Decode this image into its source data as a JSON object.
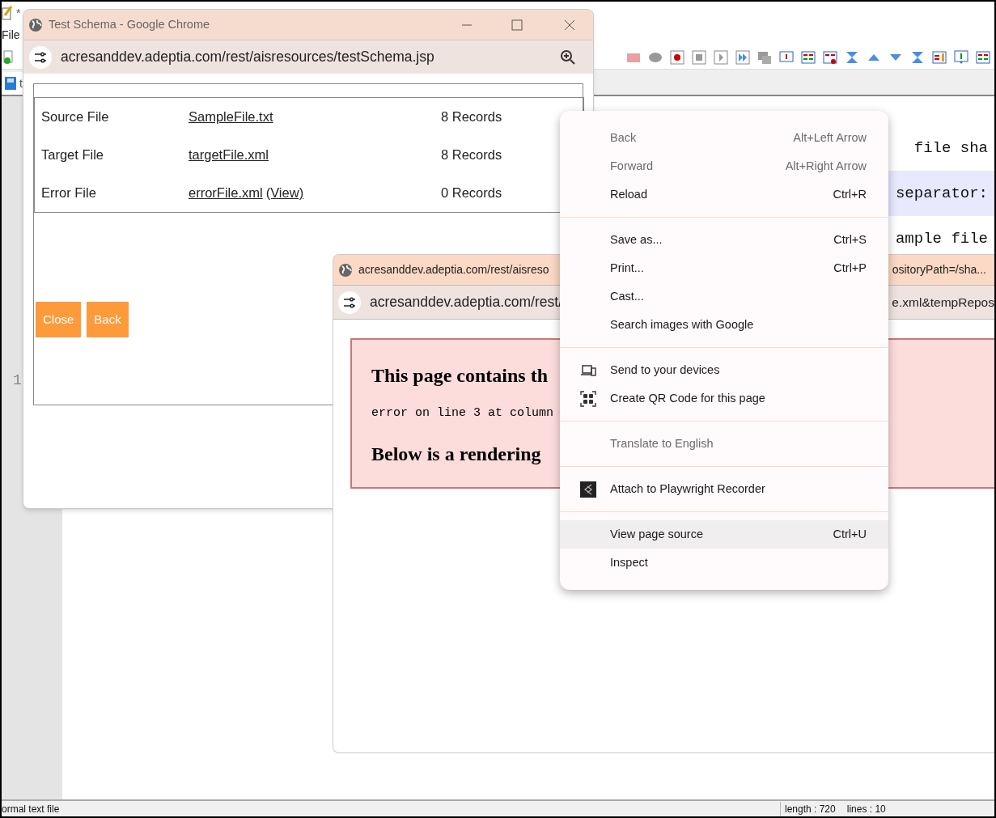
{
  "editor": {
    "title_mark": "*",
    "menu": [
      "File"
    ],
    "tab": {
      "label": "t",
      "selected": true
    },
    "gutter": {
      "line_number": "1"
    },
    "lines": [
      {
        "text": "file sha",
        "highlighted": false
      },
      {
        "text": "separator:",
        "highlighted": true
      },
      {
        "text": "ample file",
        "highlighted": false
      }
    ],
    "status_bar": {
      "file_type": "ormal text file",
      "length": "length : 720",
      "lines": "lines : 10"
    }
  },
  "window_main": {
    "title": "Test Schema - Google Chrome",
    "url": "acresanddev.adeptia.com/rest/aisresources/testSchema.jsp",
    "rows": [
      {
        "label": "Source File",
        "links": [
          "SampleFile.txt"
        ],
        "records": "8 Records"
      },
      {
        "label": "Target File",
        "links": [
          "targetFile.xml"
        ],
        "records": "8 Records"
      },
      {
        "label": "Error File",
        "links": [
          "errorFile.xml",
          "(View)"
        ],
        "records": "0 Records"
      }
    ],
    "buttons": [
      "Close",
      "Back"
    ]
  },
  "window_popup": {
    "title_left": "acresanddev.adeptia.com/rest/aisreso",
    "title_right": "ositoryPath=/sha...",
    "url_left": "acresanddev.adeptia.com/rest/",
    "url_right": "e.xml&tempRepos",
    "error": {
      "heading": "This page contains th",
      "message": "error on line 3 at column",
      "footer": "Below is a rendering"
    }
  },
  "context_menu": {
    "groups": [
      {
        "items": [
          {
            "label": "Back",
            "shortcut": "Alt+Left Arrow",
            "disabled": true,
            "selected": false,
            "kind": "plain"
          },
          {
            "label": "Forward",
            "shortcut": "Alt+Right Arrow",
            "disabled": true,
            "selected": false,
            "kind": "plain"
          },
          {
            "label": "Reload",
            "shortcut": "Ctrl+R",
            "disabled": false,
            "selected": false,
            "kind": "plain"
          }
        ]
      },
      {
        "items": [
          {
            "label": "Save as...",
            "shortcut": "Ctrl+S",
            "disabled": false,
            "selected": false,
            "kind": "plain"
          },
          {
            "label": "Print...",
            "shortcut": "Ctrl+P",
            "disabled": false,
            "selected": false,
            "kind": "plain"
          },
          {
            "label": "Cast...",
            "disabled": false,
            "selected": false,
            "kind": "plain"
          },
          {
            "label": "Search images with Google",
            "disabled": false,
            "selected": false,
            "kind": "plain"
          }
        ]
      },
      {
        "items": [
          {
            "label": "Send to your devices",
            "disabled": false,
            "selected": false,
            "kind": "devices"
          },
          {
            "label": "Create QR Code for this page",
            "disabled": false,
            "selected": false,
            "kind": "qr"
          }
        ]
      },
      {
        "items": [
          {
            "label": "Translate to English",
            "disabled": true,
            "selected": false,
            "kind": "plain"
          }
        ]
      },
      {
        "items": [
          {
            "label": "Attach to Playwright Recorder",
            "disabled": false,
            "selected": false,
            "kind": "extension"
          }
        ]
      },
      {
        "items": [
          {
            "label": "View page source",
            "shortcut": "Ctrl+U",
            "disabled": false,
            "selected": true,
            "kind": "plain"
          },
          {
            "label": "Inspect",
            "disabled": false,
            "selected": false,
            "kind": "plain"
          }
        ]
      }
    ]
  }
}
